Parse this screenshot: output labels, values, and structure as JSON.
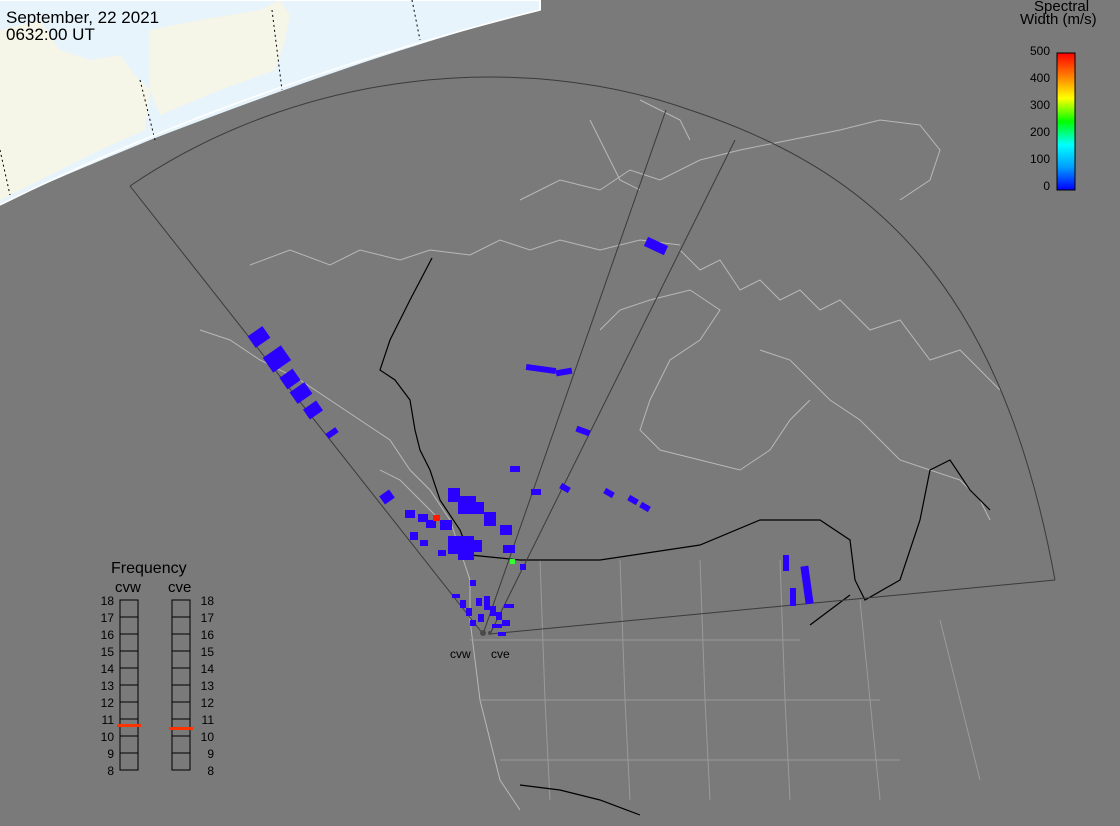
{
  "header": {
    "date": "September, 22 2021",
    "time": "0632:00 UT"
  },
  "colorbar": {
    "title_line1": "Spectral",
    "title_line2": "Width (m/s)",
    "ticks": [
      "500",
      "400",
      "300",
      "200",
      "100",
      "0"
    ],
    "colors": [
      "#0000ff",
      "#00a0ff",
      "#00ffff",
      "#00ff00",
      "#ffff00",
      "#ff8000",
      "#ff0000"
    ]
  },
  "frequency": {
    "title": "Frequency",
    "radar_left": "cvw",
    "radar_right": "cve",
    "ticks": [
      "18",
      "17",
      "16",
      "15",
      "14",
      "13",
      "12",
      "11",
      "10",
      "9",
      "8"
    ],
    "marker_color": "#ff3300"
  },
  "radars": {
    "west": "cvw",
    "east": "cve"
  },
  "map_colors": {
    "background": "#7a7a7a",
    "land_day": "#f5f5e8",
    "ocean_day": "#e8f4fc",
    "coastline": "#b8b8b8",
    "echo": "#2a00ff"
  }
}
